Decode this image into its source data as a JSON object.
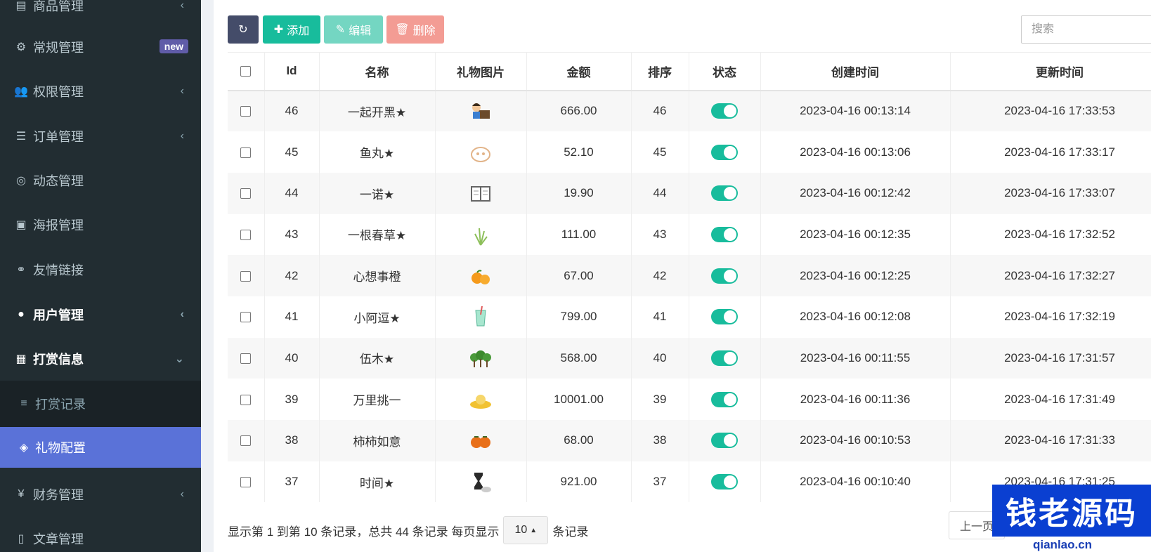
{
  "sidebar": {
    "items": [
      {
        "label": "商品管理",
        "icon": "book-icon",
        "chevron": "‹"
      },
      {
        "label": "常规管理",
        "icon": "gears-icon",
        "badge": "new"
      },
      {
        "label": "权限管理",
        "icon": "users-icon",
        "chevron": "‹"
      },
      {
        "label": "订单管理",
        "icon": "list-icon",
        "chevron": "‹"
      },
      {
        "label": "动态管理",
        "icon": "tripadvisor-icon"
      },
      {
        "label": "海报管理",
        "icon": "image-icon"
      },
      {
        "label": "友情链接",
        "icon": "link-icon"
      },
      {
        "label": "用户管理",
        "icon": "user-circle-icon",
        "chevron": "‹"
      },
      {
        "label": "打赏信息",
        "icon": "gift-icon",
        "chevron": "⌄"
      },
      {
        "label": "打赏记录",
        "icon": "bars-icon"
      },
      {
        "label": "礼物配置",
        "icon": "cube-icon"
      },
      {
        "label": "财务管理",
        "icon": "yen-icon",
        "chevron": "‹"
      },
      {
        "label": "文章管理",
        "icon": "file-icon"
      }
    ]
  },
  "toolbar": {
    "refresh_icon": "↻",
    "add_label": "添加",
    "edit_label": "编辑",
    "delete_label": "删除"
  },
  "search": {
    "placeholder": "搜索"
  },
  "table": {
    "headers": [
      "Id",
      "名称",
      "礼物图片",
      "金额",
      "排序",
      "状态",
      "创建时间",
      "更新时间"
    ],
    "rows": [
      {
        "id": "46",
        "name": "一起开黑★",
        "amount": "666.00",
        "sort": "46",
        "created": "2023-04-16 00:13:14",
        "updated": "2023-04-16 17:33:53",
        "img": "gamer-icon"
      },
      {
        "id": "45",
        "name": "鱼丸★",
        "amount": "52.10",
        "sort": "45",
        "created": "2023-04-16 00:13:06",
        "updated": "2023-04-16 17:33:17",
        "img": "fishball-icon"
      },
      {
        "id": "44",
        "name": "一诺★",
        "amount": "19.90",
        "sort": "44",
        "created": "2023-04-16 00:12:42",
        "updated": "2023-04-16 17:33:07",
        "img": "book-gift-icon"
      },
      {
        "id": "43",
        "name": "一根春草★",
        "amount": "111.00",
        "sort": "43",
        "created": "2023-04-16 00:12:35",
        "updated": "2023-04-16 17:32:52",
        "img": "grass-icon"
      },
      {
        "id": "42",
        "name": "心想事橙",
        "amount": "67.00",
        "sort": "42",
        "created": "2023-04-16 00:12:25",
        "updated": "2023-04-16 17:32:27",
        "img": "orange-icon"
      },
      {
        "id": "41",
        "name": "小阿逗★",
        "amount": "799.00",
        "sort": "41",
        "created": "2023-04-16 00:12:08",
        "updated": "2023-04-16 17:32:19",
        "img": "drink-icon"
      },
      {
        "id": "40",
        "name": "伍木★",
        "amount": "568.00",
        "sort": "40",
        "created": "2023-04-16 00:11:55",
        "updated": "2023-04-16 17:31:57",
        "img": "trees-icon"
      },
      {
        "id": "39",
        "name": "万里挑一",
        "amount": "10001.00",
        "sort": "39",
        "created": "2023-04-16 00:11:36",
        "updated": "2023-04-16 17:31:49",
        "img": "ingot-icon"
      },
      {
        "id": "38",
        "name": "柿柿如意",
        "amount": "68.00",
        "sort": "38",
        "created": "2023-04-16 00:10:53",
        "updated": "2023-04-16 17:31:33",
        "img": "persimmon-icon"
      },
      {
        "id": "37",
        "name": "时间★",
        "amount": "921.00",
        "sort": "37",
        "created": "2023-04-16 00:10:40",
        "updated": "2023-04-16 17:31:25",
        "img": "hourglass-icon"
      }
    ]
  },
  "pager": {
    "info_prefix": "显示第 1 到第 10 条记录，总共 44 条记录 每页显示",
    "page_size": "10",
    "info_suffix": "条记录",
    "prev_label": "上一页"
  },
  "watermark": {
    "text": "钱老源码",
    "url": "qianlao.cn"
  },
  "colors": {
    "sidebar_bg": "#222d32",
    "active": "#5a72d8",
    "success": "#18bc9c",
    "danger": "#f39c94",
    "badge": "#605ca8"
  }
}
